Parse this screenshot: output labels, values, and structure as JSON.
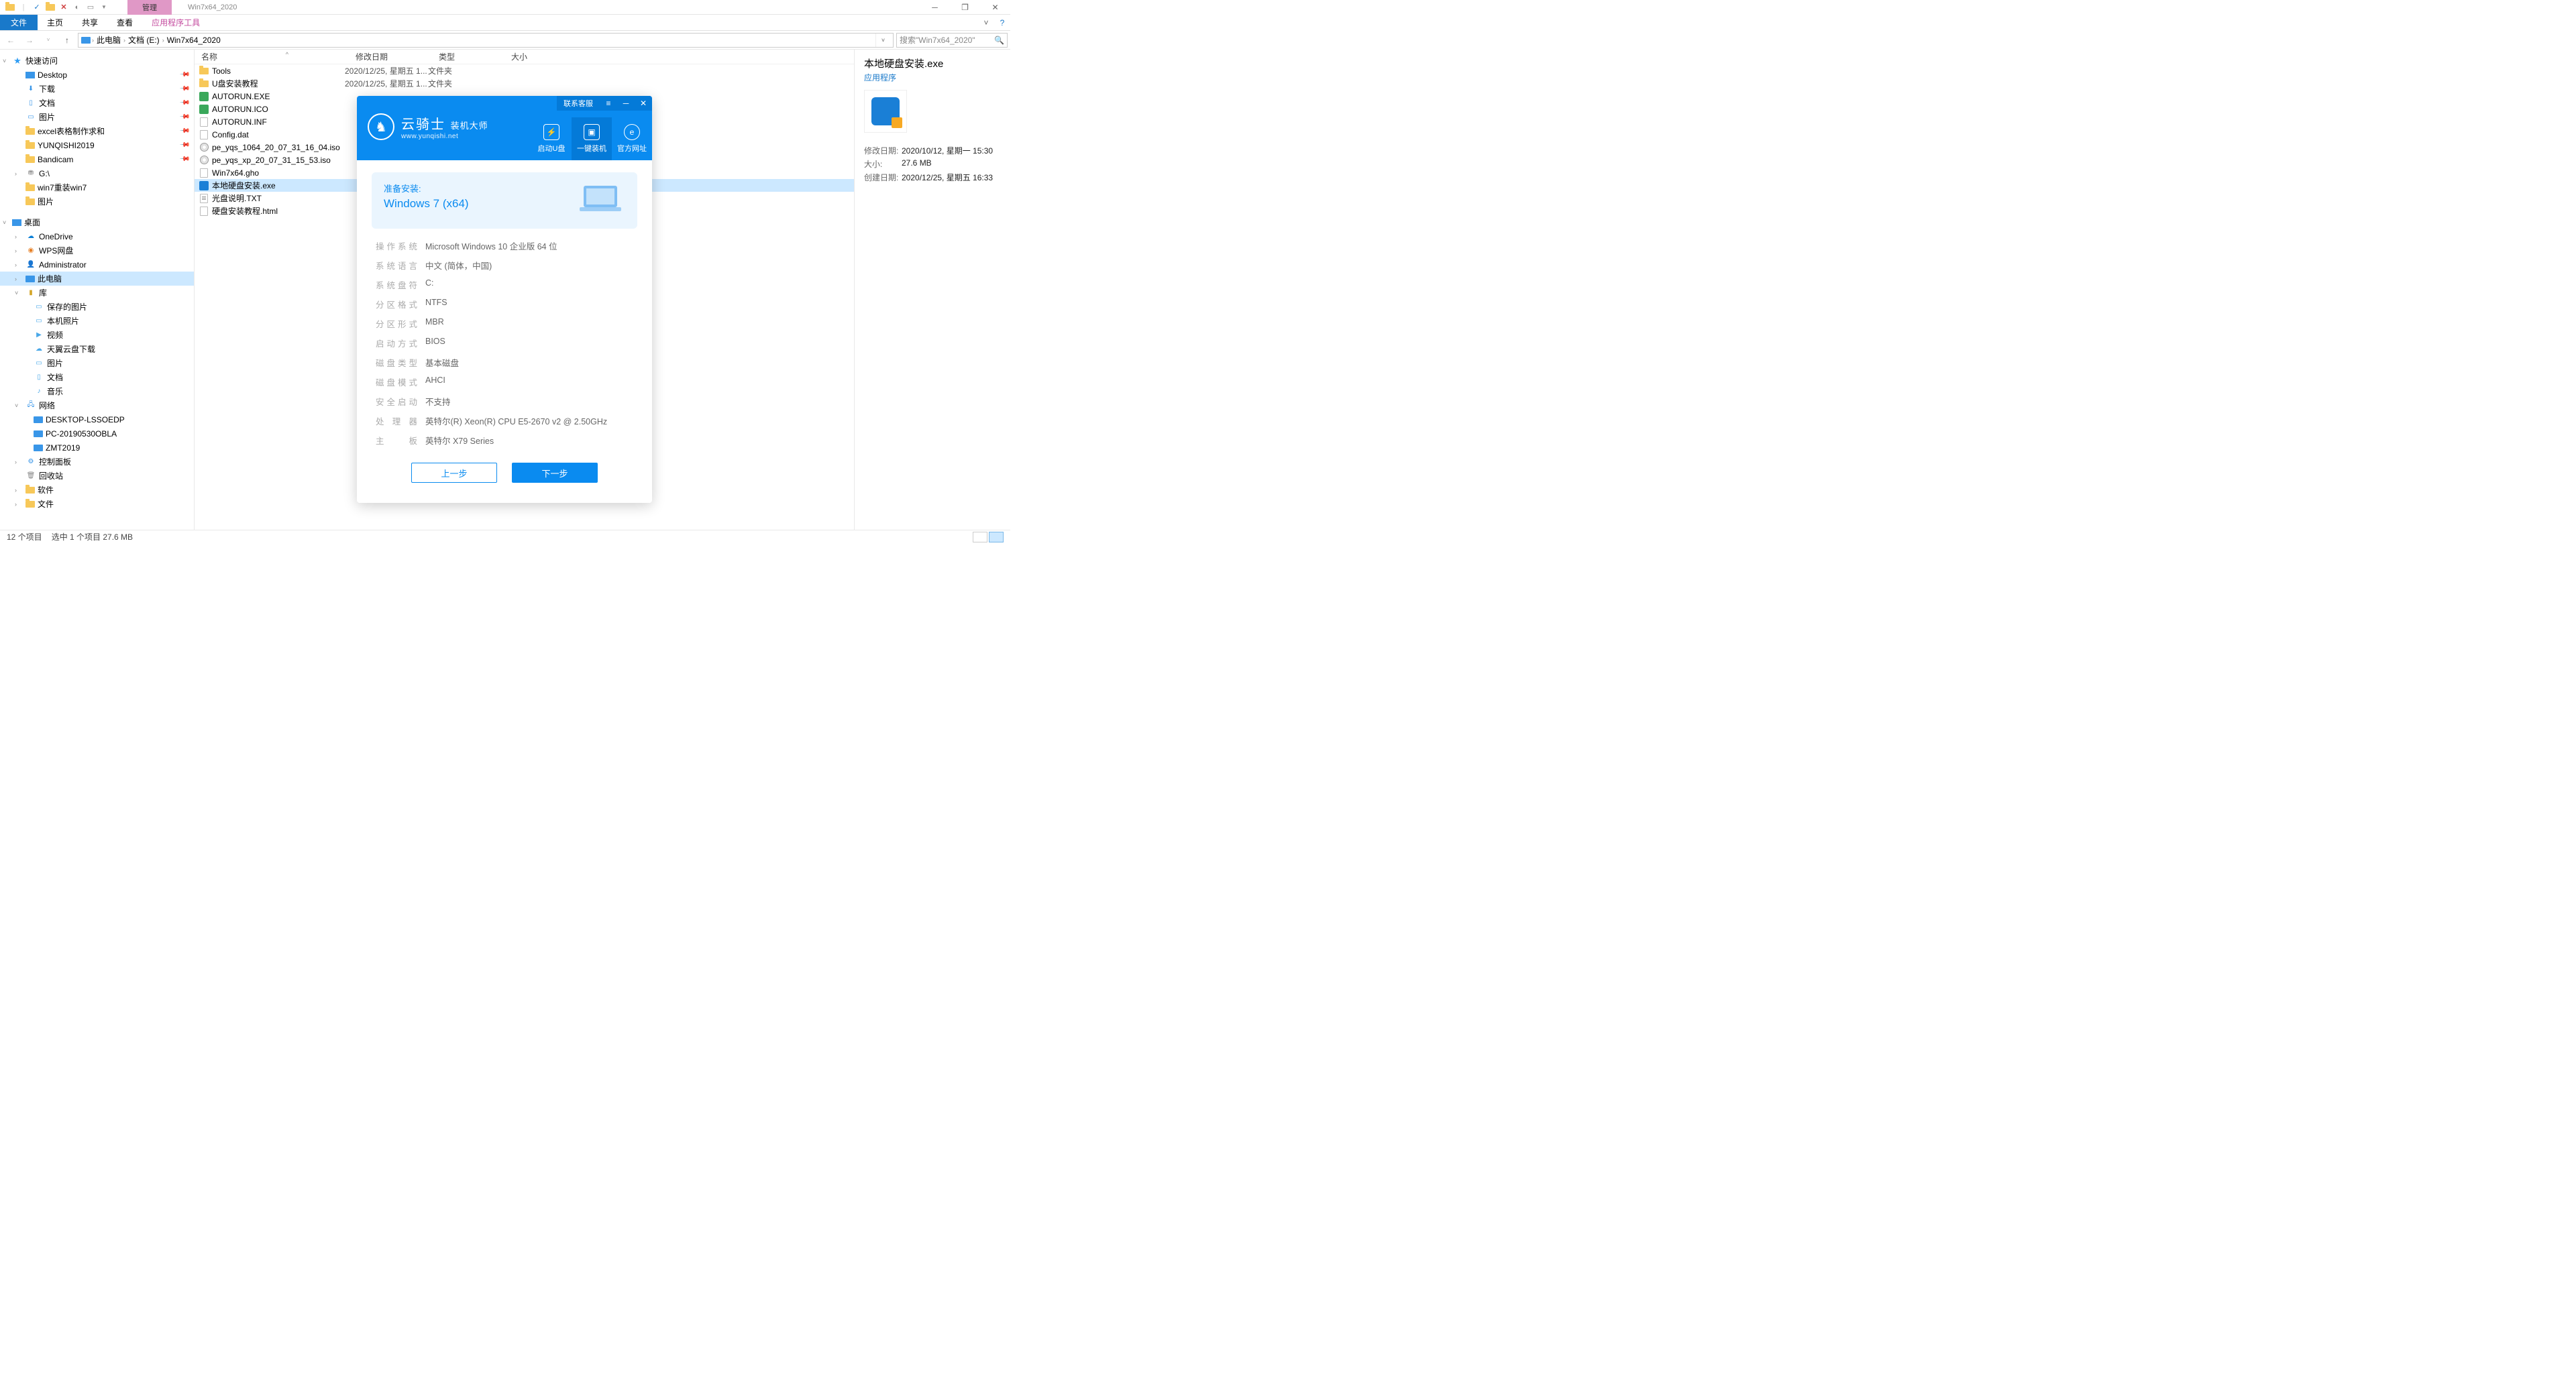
{
  "window": {
    "context_tab": "管理",
    "title": "Win7x64_2020"
  },
  "ribbon": {
    "file": "文件",
    "tabs": [
      "主页",
      "共享",
      "查看"
    ],
    "app_tab": "应用程序工具"
  },
  "breadcrumb": {
    "segs": [
      "此电脑",
      "文档 (E:)",
      "Win7x64_2020"
    ]
  },
  "search": {
    "placeholder": "搜索\"Win7x64_2020\""
  },
  "nav": {
    "quick": {
      "label": "快速访问",
      "items": [
        "Desktop",
        "下载",
        "文档",
        "图片",
        "excel表格制作求和",
        "YUNQISHI2019",
        "Bandicam",
        "G:\\",
        "win7重装win7",
        "图片"
      ]
    },
    "desktop": {
      "label": "桌面",
      "items": [
        "OneDrive",
        "WPS网盘",
        "Administrator",
        "此电脑",
        "库",
        "网络",
        "控制面板",
        "回收站",
        "软件",
        "文件"
      ]
    },
    "lib_items": [
      "保存的图片",
      "本机照片",
      "视频",
      "天翼云盘下载",
      "图片",
      "文档",
      "音乐"
    ],
    "net_items": [
      "DESKTOP-LSSOEDP",
      "PC-20190530OBLA",
      "ZMT2019"
    ]
  },
  "columns": {
    "name": "名称",
    "date": "修改日期",
    "type": "类型",
    "size": "大小"
  },
  "files": [
    {
      "icon": "folder",
      "name": "Tools",
      "date": "2020/12/25, 星期五 1...",
      "type": "文件夹",
      "size": ""
    },
    {
      "icon": "folder",
      "name": "U盘安装教程",
      "date": "2020/12/25, 星期五 1...",
      "type": "文件夹",
      "size": ""
    },
    {
      "icon": "exe-g",
      "name": "AUTORUN.EXE",
      "date": "",
      "type": "",
      "size": ""
    },
    {
      "icon": "ico-g",
      "name": "AUTORUN.ICO",
      "date": "",
      "type": "",
      "size": ""
    },
    {
      "icon": "file",
      "name": "AUTORUN.INF",
      "date": "",
      "type": "",
      "size": ""
    },
    {
      "icon": "file",
      "name": "Config.dat",
      "date": "",
      "type": "",
      "size": ""
    },
    {
      "icon": "disc",
      "name": "pe_yqs_1064_20_07_31_16_04.iso",
      "date": "",
      "type": "",
      "size": ""
    },
    {
      "icon": "disc",
      "name": "pe_yqs_xp_20_07_31_15_53.iso",
      "date": "",
      "type": "",
      "size": ""
    },
    {
      "icon": "file",
      "name": "Win7x64.gho",
      "date": "",
      "type": "",
      "size": ""
    },
    {
      "icon": "app",
      "name": "本地硬盘安装.exe",
      "date": "",
      "type": "",
      "size": "",
      "sel": true
    },
    {
      "icon": "txt",
      "name": "光盘说明.TXT",
      "date": "",
      "type": "",
      "size": ""
    },
    {
      "icon": "file",
      "name": "硬盘安装教程.html",
      "date": "",
      "type": "",
      "size": ""
    }
  ],
  "details": {
    "name": "本地硬盘安装.exe",
    "type": "应用程序",
    "rows": [
      {
        "k": "修改日期:",
        "v": "2020/10/12, 星期一 15:30"
      },
      {
        "k": "大小:",
        "v": "27.6 MB"
      },
      {
        "k": "创建日期:",
        "v": "2020/12/25, 星期五 16:33"
      }
    ]
  },
  "status": {
    "count": "12 个项目",
    "selected": "选中 1 个项目  27.6 MB"
  },
  "app": {
    "cs": "联系客服",
    "brand_main": "云骑士",
    "brand_sub": "装机大师",
    "brand_url": "www.yunqishi.net",
    "nav": [
      "启动U盘",
      "一键装机",
      "官方网址"
    ],
    "prep_title": "准备安装:",
    "prep_os": "Windows 7 (x64)",
    "info": [
      {
        "k": "操作系统",
        "v": "Microsoft Windows 10 企业版 64 位"
      },
      {
        "k": "系统语言",
        "v": "中文 (简体，中国)"
      },
      {
        "k": "系统盘符",
        "v": "C:"
      },
      {
        "k": "分区格式",
        "v": "NTFS"
      },
      {
        "k": "分区形式",
        "v": "MBR"
      },
      {
        "k": "启动方式",
        "v": "BIOS"
      },
      {
        "k": "磁盘类型",
        "v": "基本磁盘"
      },
      {
        "k": "磁盘模式",
        "v": "AHCI"
      },
      {
        "k": "安全启动",
        "v": "不支持"
      },
      {
        "k": "处理器",
        "v": "英特尔(R) Xeon(R) CPU E5-2670 v2 @ 2.50GHz"
      },
      {
        "k": "主板",
        "v": "英特尔 X79 Series"
      }
    ],
    "btn_prev": "上一步",
    "btn_next": "下一步"
  }
}
